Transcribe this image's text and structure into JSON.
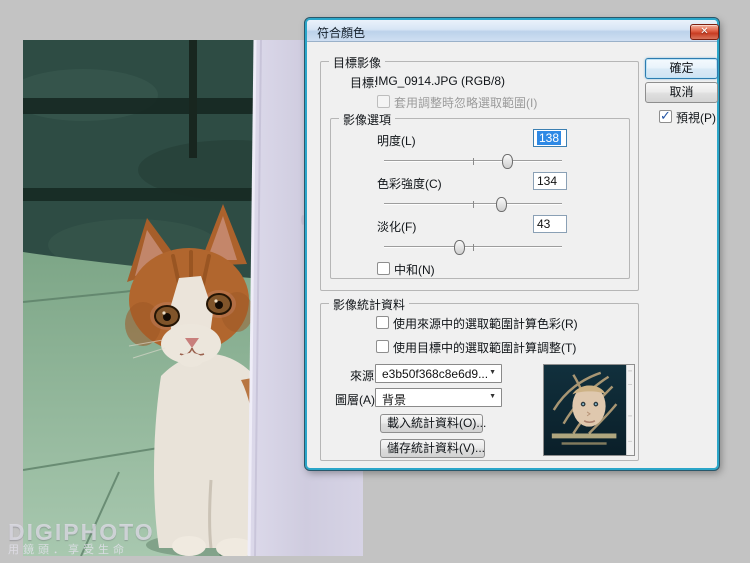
{
  "window": {
    "title": "符合顏色"
  },
  "icons": {
    "close_glyph": "✕",
    "dropdown_arrow": "▼",
    "check_glyph": "✓"
  },
  "target_image": {
    "group_label": "目標影像",
    "target_label": "目標:",
    "target_value": "IMG_0914.JPG (RGB/8)",
    "ignore_selection_label": "套用調整時忽略選取範圍(I)",
    "ignore_selection_checked": false
  },
  "image_options": {
    "group_label": "影像選項",
    "luminance": {
      "label": "明度(L)",
      "value": "138",
      "slider_percent": 69
    },
    "color_intensity": {
      "label": "色彩強度(C)",
      "value": "134",
      "slider_percent": 66
    },
    "fade": {
      "label": "淡化(F)",
      "value": "43",
      "slider_percent": 42
    },
    "neutralize": {
      "label": "中和(N)",
      "checked": false
    }
  },
  "image_statistics": {
    "group_label": "影像統計資料",
    "use_source_selection": {
      "label": "使用來源中的選取範圍計算色彩(R)",
      "checked": false
    },
    "use_target_selection": {
      "label": "使用目標中的選取範圍計算調整(T)",
      "checked": false
    },
    "source_label": "來源:",
    "source_value": "e3b50f368c8e6d9...",
    "layer_label": "圖層(A):",
    "layer_value": "背景",
    "load_stats_button": "載入統計資料(O)...",
    "save_stats_button": "儲存統計資料(V)..."
  },
  "actions": {
    "ok_button": "確定",
    "cancel_button": "取消",
    "preview": {
      "label": "預視(P)",
      "checked": true
    }
  },
  "watermark": {
    "brand": "DIGIPHOTO",
    "slogan": "用鏡頭．享受生命"
  },
  "colors": {
    "selection_blue": "#2e89e5",
    "dialog_border": "#2ba6c9",
    "close_button_red": "#d0452c",
    "canvas_gray": "#c3c3c3"
  }
}
